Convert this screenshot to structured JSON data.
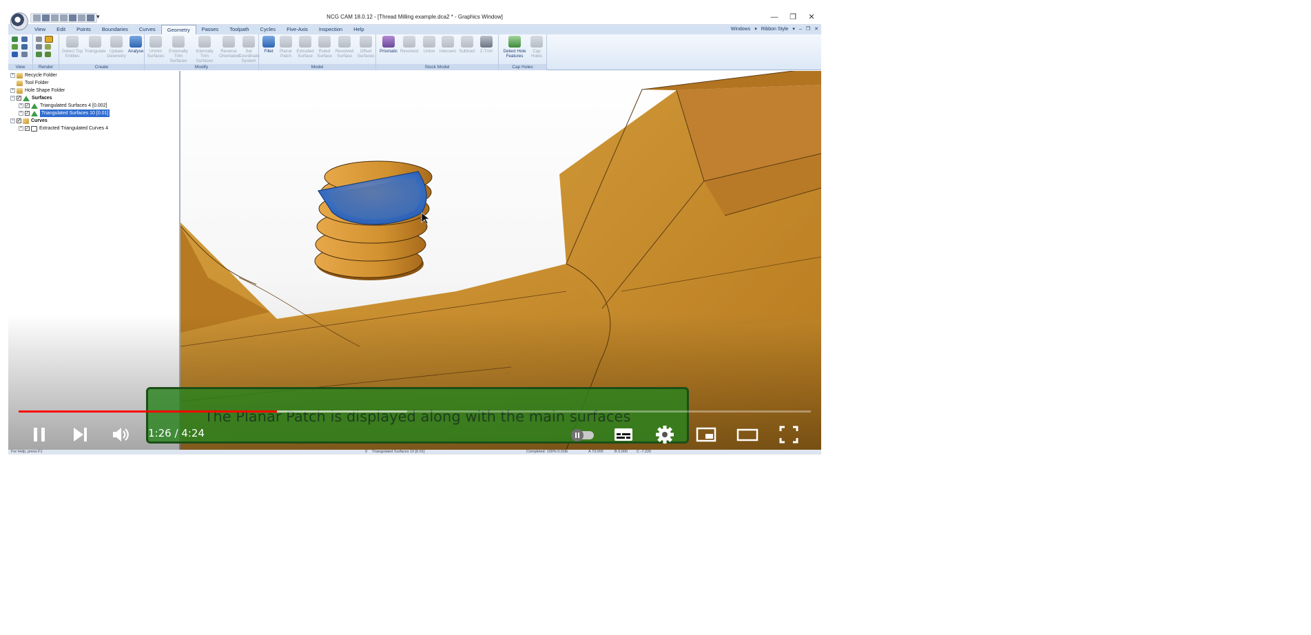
{
  "window": {
    "title": "NCG CAM 18.0.12 - [Thread Milling example.dca2 * - Graphics Window]",
    "qat_more": "▾",
    "controls": [
      "—",
      "❐",
      "✕"
    ]
  },
  "tabs": [
    "View",
    "Edit",
    "Points",
    "Boundaries",
    "Curves",
    "Geometry",
    "Passes",
    "Toolpath",
    "Cycles",
    "Five-Axis",
    "Inspection",
    "Help"
  ],
  "active_tab": "Geometry",
  "tabs_right": [
    "Windows",
    "▾",
    "Ribbon Style",
    "▾",
    "–",
    "❐",
    "✕"
  ],
  "ribbon": {
    "groups": [
      "View",
      "Render",
      "Create",
      "Modify",
      "Model",
      "Stock Model",
      "Cap Holes"
    ],
    "create": {
      "b1a": "Detect Top",
      "b1b": "Entities",
      "b2": "Triangulate",
      "b3a": "Update",
      "b3b": "Geometry",
      "b4": "Analyse"
    },
    "modify": {
      "b1a": "Untrim",
      "b1b": "Surfaces",
      "b2a": "Externally",
      "b2b": "Trim Surfaces",
      "b3a": "Internally",
      "b3b": "Trim Surfaces",
      "b4a": "Reverse",
      "b4b": "Orientation",
      "b5a": "Set Coordinate",
      "b5b": "System"
    },
    "model": {
      "b1": "Fillet",
      "b2a": "Planar",
      "b2b": "Patch",
      "b3a": "Extruded",
      "b3b": "Surface",
      "b4a": "Ruled",
      "b4b": "Surface",
      "b5a": "Revolved",
      "b5b": "Surface",
      "b6a": "Offset",
      "b6b": "Surfaces"
    },
    "stock": {
      "b1": "Prismatic",
      "b2": "Revolved",
      "b3": "Union",
      "b4": "Intersect",
      "b5": "Subtract",
      "b6": "Z-Trim"
    },
    "cap": {
      "b1a": "Detect Hole",
      "b1b": "Features",
      "b2a": "Cap",
      "b2b": "Holes"
    }
  },
  "tree": {
    "recycle": "Recycle Folder",
    "tool": "Tool Folder",
    "hole_shape": "Hole Shape Folder",
    "surfaces": "Surfaces",
    "tri_surf_4": "Triangulated Surfaces 4 [0.002]",
    "tri_surf_10": "Triangulated Surfaces 10 [0.01]",
    "curves": "Curves",
    "extracted": "Extracted Triangulated Curves 4",
    "expand_glyph": "+",
    "collapse_glyph": "−",
    "check_glyph": "✓"
  },
  "statusbar": {
    "help": "For Help, press F1",
    "count": "0",
    "selection": "Triangulated Surfaces 10 [0.01]",
    "completed": "Completed: 100%  0.01lb",
    "a": "A 73.000",
    "b": "B 0.000",
    "c": "C -7.220"
  },
  "player": {
    "caption": "The Planar Patch is displayed along with the main surfaces",
    "time": "1:26 / 4:24",
    "progress": 0.326,
    "buffered": 0.49
  },
  "colors": {
    "part": "#c8862a",
    "patch": "#2e63b8",
    "accent": "#ff0000",
    "caption_bg": "#2f8a22"
  }
}
